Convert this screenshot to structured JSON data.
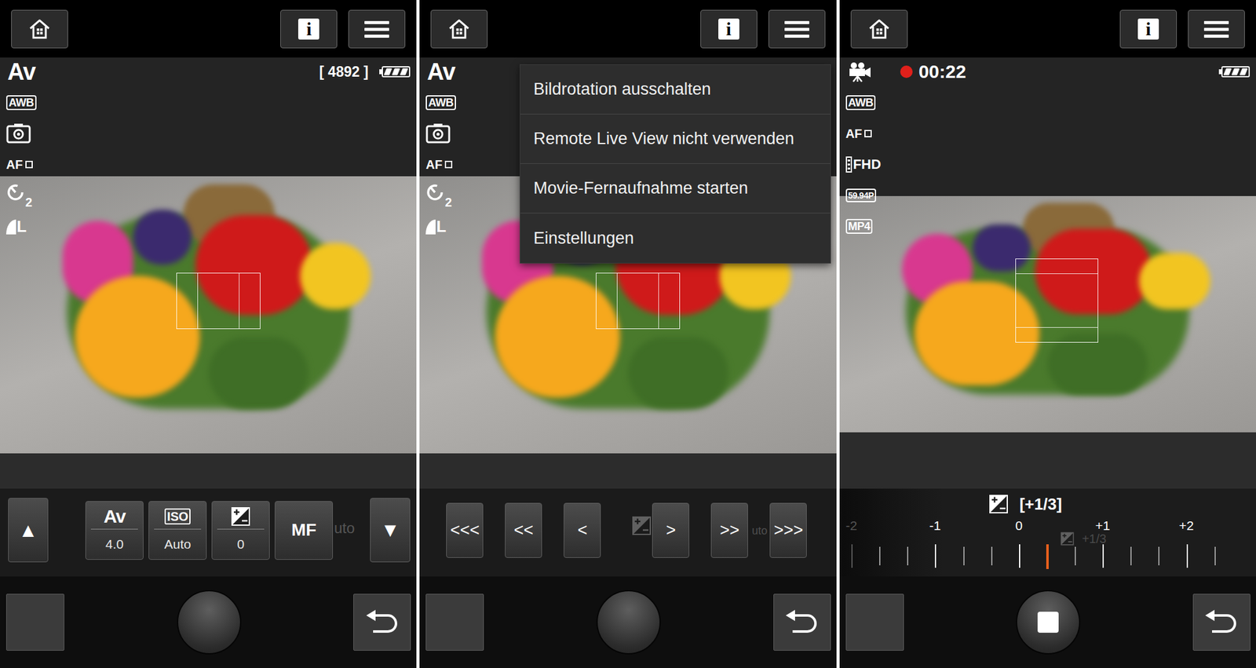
{
  "panels": [
    {
      "kind": "still",
      "header": {
        "info": "i"
      },
      "status": {
        "mode": "Av",
        "counter": "[ 4892 ]",
        "battery": {
          "level": 1
        }
      },
      "indicators": [
        {
          "kind": "boxed",
          "text": "AWB"
        },
        {
          "kind": "metering"
        },
        {
          "kind": "af",
          "text": "AF"
        },
        {
          "kind": "timer",
          "text": "2"
        },
        {
          "kind": "quality",
          "text": "L"
        }
      ],
      "controls": [
        {
          "kind": "arrow",
          "text": "▲"
        },
        {
          "kind": "setting",
          "label": "Av",
          "value": "4.0"
        },
        {
          "kind": "setting-boxed",
          "label": "ISO",
          "value": "Auto"
        },
        {
          "kind": "setting-icon",
          "value": "0"
        },
        {
          "kind": "plain",
          "text": "MF"
        },
        {
          "kind": "arrow",
          "text": "▼"
        }
      ],
      "ghost": [
        "uto"
      ],
      "shutter": {
        "recording": false
      }
    },
    {
      "kind": "still",
      "header": {
        "info": "i"
      },
      "status": {
        "mode": "Av"
      },
      "indicators": [
        {
          "kind": "boxed",
          "text": "AWB"
        },
        {
          "kind": "metering"
        },
        {
          "kind": "af",
          "text": "AF"
        },
        {
          "kind": "timer",
          "text": "2"
        },
        {
          "kind": "quality",
          "text": "L"
        }
      ],
      "menu": [
        "Bildrotation ausschalten",
        "Remote Live View nicht verwenden",
        "Movie-Fernaufnahme starten",
        "Einstellungen"
      ],
      "controls": [
        {
          "kind": "step",
          "text": "<<<"
        },
        {
          "kind": "step",
          "text": "<<"
        },
        {
          "kind": "step",
          "text": "<"
        },
        {
          "kind": "step",
          "text": ">"
        },
        {
          "kind": "step",
          "text": ">>"
        },
        {
          "kind": "step",
          "text": ">>>"
        }
      ],
      "ghost": [
        "uto"
      ],
      "shutter": {
        "recording": false
      }
    },
    {
      "kind": "movie",
      "header": {
        "info": "i"
      },
      "status": {
        "recording": true,
        "time": "00:22",
        "battery": {
          "level": 1
        }
      },
      "indicators": [
        {
          "kind": "boxed",
          "text": "AWB"
        },
        {
          "kind": "af",
          "text": "AF"
        },
        {
          "kind": "fhd",
          "text": "FHD"
        },
        {
          "kind": "boxed-small",
          "text": "59.94P"
        },
        {
          "kind": "boxed",
          "text": "MP4"
        }
      ],
      "exposure": {
        "title": "[+1/3]",
        "level": 0.5,
        "ticks": [
          {
            "label": "-2",
            "value": -2,
            "faded": true
          },
          {
            "label": "-1",
            "value": -1,
            "faded": false
          },
          {
            "label": "0",
            "value": 0,
            "faded": false
          },
          {
            "label": "+1",
            "value": 1,
            "faded": false
          },
          {
            "label": "+2",
            "value": 2,
            "faded": false
          }
        ]
      },
      "ghost": [
        "+1/3"
      ],
      "shutter": {
        "recording": true
      }
    }
  ]
}
